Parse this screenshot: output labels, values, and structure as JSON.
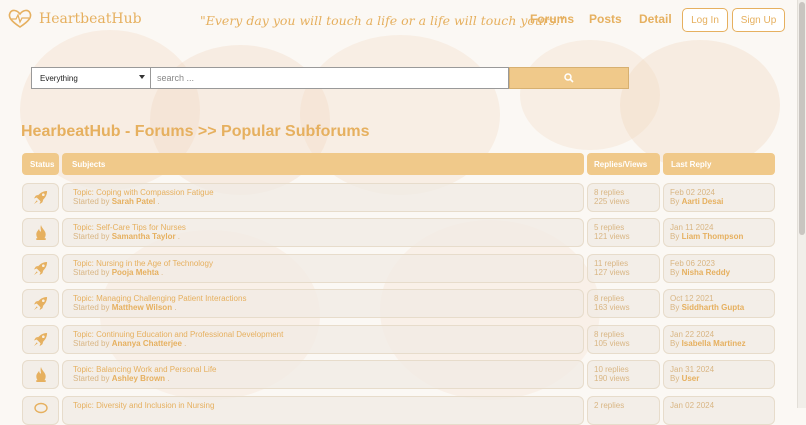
{
  "header": {
    "logo_text": "HeartbeatHub",
    "tagline": "\"Every day you will touch a life or a life will touch yours.\"",
    "nav": [
      "Forums",
      "Posts",
      "Detail"
    ],
    "login_label": "Log In",
    "signup_label": "Sign Up"
  },
  "search": {
    "select_value": "Everything",
    "placeholder": "search ..."
  },
  "page_title": "HearbeatHub - Forums >> Popular Subforums",
  "table": {
    "headers": [
      "Status",
      "Subjects",
      "Replies/Views",
      "Last Reply"
    ],
    "rows": [
      {
        "icon": "rocket-icon",
        "topic": "Topic: Coping with Compassion Fatigue",
        "started_prefix": "Started by",
        "author": "Sarah Patel",
        "replies": "8 replies",
        "views": "225 views",
        "date": "Feb 02 2024",
        "by_prefix": "By",
        "last_user": "Aarti Desai"
      },
      {
        "icon": "fire-icon",
        "topic": "Topic: Self-Care Tips for Nurses",
        "started_prefix": "Started by",
        "author": "Samantha Taylor",
        "replies": "5 replies",
        "views": "121 views",
        "date": "Jan 11 2024",
        "by_prefix": "By",
        "last_user": "Liam Thompson"
      },
      {
        "icon": "rocket-icon",
        "topic": "Topic: Nursing in the Age of Technology",
        "started_prefix": "Started by",
        "author": "Pooja Mehta",
        "replies": "11 replies",
        "views": "127 views",
        "date": "Feb 06 2023",
        "by_prefix": "By",
        "last_user": "Nisha Reddy"
      },
      {
        "icon": "rocket-icon",
        "topic": "Topic: Managing Challenging Patient Interactions",
        "started_prefix": "Started by",
        "author": "Matthew Wilson",
        "replies": "8 replies",
        "views": "163 views",
        "date": "Oct 12 2021",
        "by_prefix": "By",
        "last_user": "Siddharth Gupta"
      },
      {
        "icon": "rocket-icon",
        "topic": "Topic: Continuing Education and Professional Development",
        "started_prefix": "Started by",
        "author": "Ananya Chatterjee",
        "replies": "8 replies",
        "views": "105 views",
        "date": "Jan 22 2024",
        "by_prefix": "By",
        "last_user": "Isabella Martinez"
      },
      {
        "icon": "fire-icon",
        "topic": "Topic: Balancing Work and Personal Life",
        "started_prefix": "Started by",
        "author": "Ashley Brown",
        "replies": "10 replies",
        "views": "190 views",
        "date": "Jan 31 2024",
        "by_prefix": "By",
        "last_user": "User"
      },
      {
        "icon": "comment-icon",
        "topic": "Topic: Diversity and Inclusion in Nursing",
        "started_prefix": "",
        "author": "",
        "replies": "2 replies",
        "views": "",
        "date": "Jan 02 2024",
        "by_prefix": "",
        "last_user": ""
      }
    ]
  },
  "colors": {
    "accent": "#e6b05f",
    "header_bg": "#f0c98a",
    "row_bg": "#f0ebe4"
  }
}
